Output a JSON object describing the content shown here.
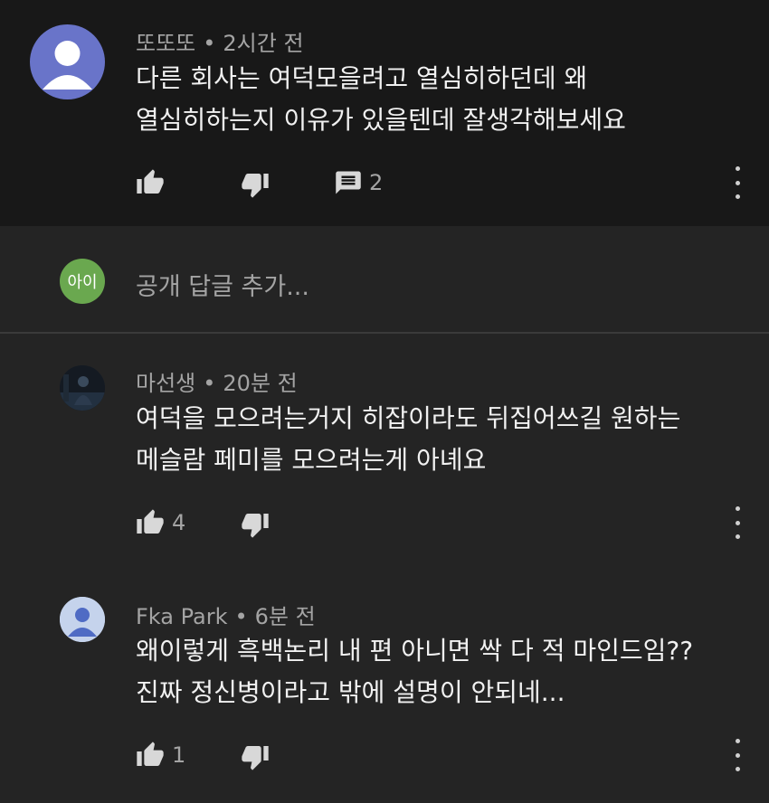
{
  "top_comment": {
    "author": "또또또",
    "time": "2시간 전",
    "lines": [
      "다른 회사는 여덕모을려고 열심히하던데 왜",
      "열심히하는지 이유가 있을텐데 잘생각해보세요"
    ],
    "replies_count": "2"
  },
  "reply_input": {
    "avatar_text": "아이",
    "placeholder": "공개 답글 추가..."
  },
  "replies": [
    {
      "author": "마선생",
      "time": "20분 전",
      "lines": [
        "여덕을 모으려는거지 히잡이라도 뒤집어쓰길 원하는",
        "메슬람 페미를 모으려는게 아녜요"
      ],
      "likes": "4"
    },
    {
      "author": "Fka Park",
      "time": "6분 전",
      "lines": [
        "왜이렇게 흑백논리 내 편 아니면 싹 다 적 마인드임??",
        "진짜 정신병이라고 밖에 설명이 안되네..."
      ],
      "likes": "1"
    }
  ],
  "icons": {
    "like": "thumbs-up-icon",
    "dislike": "thumbs-down-icon",
    "reply": "comment-icon",
    "more": "more-vertical-icon"
  },
  "colors": {
    "top_bg": "#181818",
    "page_bg": "#242424",
    "my_avatar": "#6aa84f",
    "avatar_default": "#6974c9"
  }
}
